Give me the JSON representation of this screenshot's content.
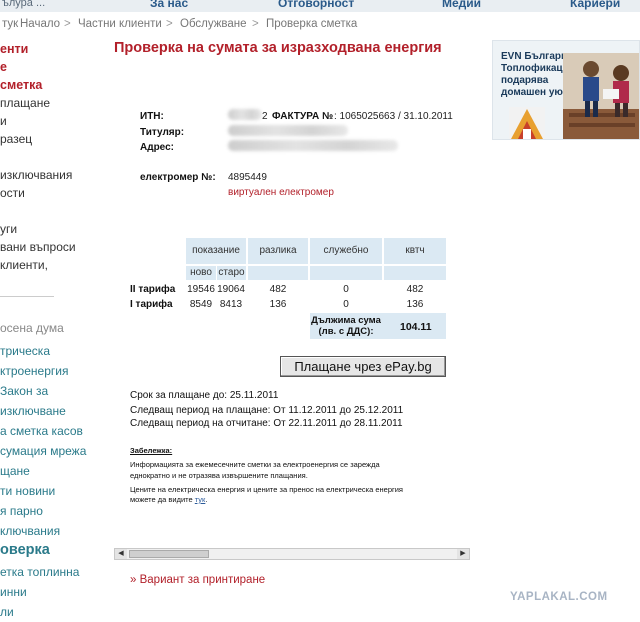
{
  "topnav": {
    "brand": "ълура ...",
    "items": [
      "За нас",
      "Отговорност",
      "Медии",
      "Кариери"
    ]
  },
  "breadcrumb": [
    "тук",
    "Начало",
    "Частни клиенти",
    "Обслужване",
    "Проверка сметка"
  ],
  "sidebar": {
    "items": [
      "енти",
      "е",
      "сметка",
      "плащане",
      "и",
      "разец",
      "",
      "изключвания",
      "ости",
      "",
      "уги",
      "вани въпроси",
      "клиенти,",
      "",
      "осена дума",
      "трическа",
      "ктроенергия",
      "Закон за",
      " изключване",
      "а сметка  касов",
      "сумация  мрежа",
      "щане",
      "ти  новини",
      "я  парно",
      "ключвания",
      "оверка",
      "етка  топлинна",
      "инни",
      "ли"
    ]
  },
  "promo": {
    "lines": [
      "EVN България",
      "Топлофикация",
      "подарява",
      "домашен уют."
    ],
    "accent": "#e8a030"
  },
  "main": {
    "title": "Проверка на сумата за изразходвана енергия",
    "itn_label": "ИТН:",
    "itn_value_tail": "2",
    "invoice_label": "ФАКТУРА №",
    "invoice_value": ": 1065025663 /  31.10.2011",
    "holder_label": "Титуляр:",
    "address_label": "Адрес:",
    "meter_label": "електромер №:",
    "meter_value": "4895449",
    "meter_note": "виртуален електромер"
  },
  "table": {
    "headers": [
      "показание",
      "разлика",
      "служебно",
      "квтч"
    ],
    "subheaders": [
      "ново",
      "старо"
    ],
    "rows": [
      {
        "label": "II тарифа",
        "new": "19546",
        "old": "19064",
        "diff": "482",
        "service": "0",
        "kwh": "482"
      },
      {
        "label": "I тарифа",
        "new": "8549",
        "old": "8413",
        "diff": "136",
        "service": "0",
        "kwh": "136"
      }
    ],
    "due_label_1": "Дължима сума",
    "due_label_2": "(лв. с ДДС):",
    "due_value": "104.11"
  },
  "pay_button": "Плащане чрез ePay.bg",
  "payment": {
    "deadline": "Срок за плащане до: 25.11.2011",
    "next_payment": "Следващ период на плащане: От 11.12.2011 до 25.12.2011",
    "next_reading": "Следващ период на отчитане: От 22.11.2011 до 28.11.2011"
  },
  "notes": {
    "heading": "Забележка:",
    "line1": "Информацията за ежемесечните сметки за електроенергия се зарежда",
    "line2": "еднократно и не отразява извършените плащания.",
    "line3": "Цените на електрическа енергия и цените за пренос на електрическа енергия",
    "line4_prefix": "можете да видите",
    "line4_link": "тук",
    "line4_suffix": "."
  },
  "print_link_prefix": "»",
  "print_link": "Вариант за принтиране",
  "watermark": "YAPLAKAL.COM",
  "colors": {
    "brand_red": "#b2202a",
    "link_teal": "#2a7a8a",
    "table_header_bg": "#dbe9f3"
  }
}
